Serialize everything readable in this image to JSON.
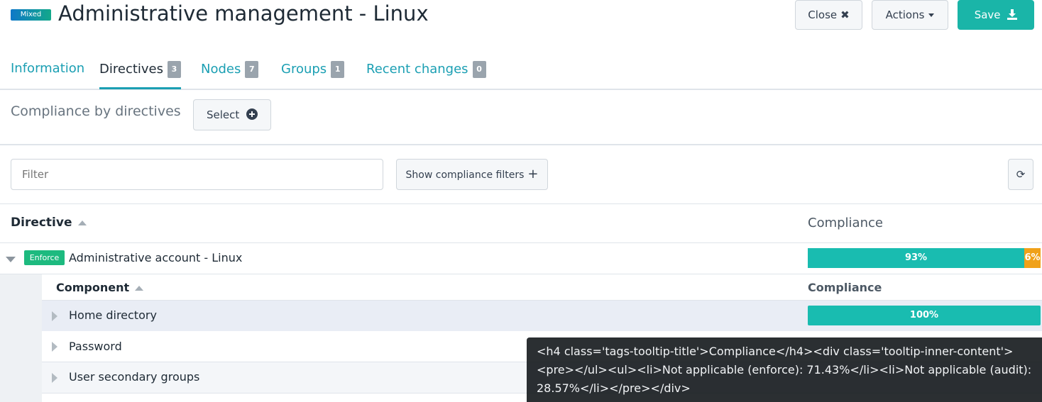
{
  "header": {
    "badge": "Mixed",
    "title": "Administrative management - Linux",
    "close_label": "Close",
    "actions_label": "Actions",
    "save_label": "Save"
  },
  "tabs": [
    {
      "label": "Information"
    },
    {
      "label": "Directives",
      "count": "3"
    },
    {
      "label": "Nodes",
      "count": "7"
    },
    {
      "label": "Groups",
      "count": "1"
    },
    {
      "label": "Recent changes",
      "count": "0"
    }
  ],
  "compliance_section": {
    "label": "Compliance by directives",
    "select_label": "Select"
  },
  "filters": {
    "placeholder": "Filter",
    "show_filters_label": "Show compliance filters"
  },
  "table": {
    "col_directive": "Directive",
    "col_compliance": "Compliance",
    "directive": {
      "badge": "Enforce",
      "name": "Administrative account - Linux",
      "bar": [
        {
          "label": "93%",
          "value": 93,
          "color": "#19bcb0"
        },
        {
          "label": "6%",
          "value": 6,
          "color": "#f0a119"
        }
      ]
    },
    "sub_col_component": "Component",
    "sub_col_compliance": "Compliance",
    "components": [
      {
        "name": "Home directory",
        "bar_label": "100%"
      },
      {
        "name": "Password"
      },
      {
        "name": "User secondary groups"
      }
    ]
  },
  "tooltip": {
    "text": "<h4 class='tags-tooltip-title'>Compliance</h4><div class='tooltip-inner-content'><pre></ul><ul><li>Not applicable (enforce): 71.43%</li><li>Not applicable (audit): 28.57%</li></pre></div>"
  },
  "colors": {
    "accent": "#1b9fb3",
    "save": "#1ab5a8",
    "success_bar": "#19bcb0",
    "warning_bar": "#f0a119",
    "enforce_badge": "#1dba7f"
  }
}
